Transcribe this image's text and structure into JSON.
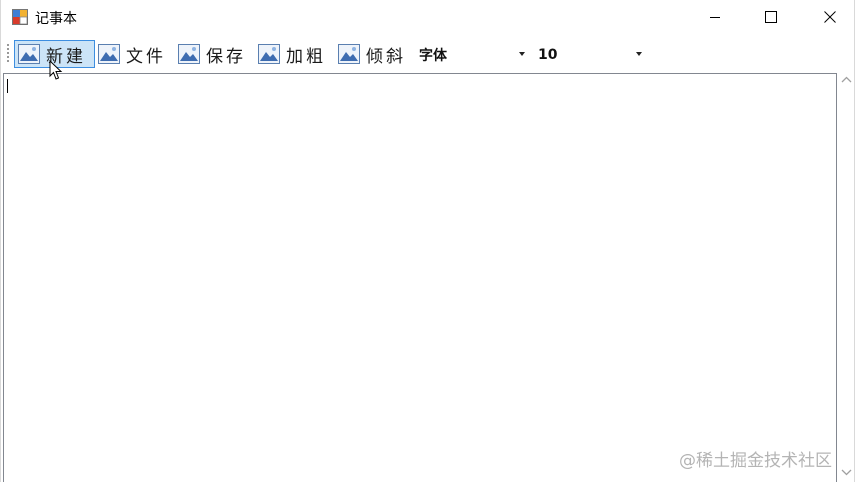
{
  "window": {
    "title": "记事本"
  },
  "toolbar": {
    "buttons": [
      {
        "label": "新建",
        "icon": "picture-icon",
        "hovered": true
      },
      {
        "label": "文件",
        "icon": "picture-icon"
      },
      {
        "label": "保存",
        "icon": "picture-icon"
      },
      {
        "label": "加粗",
        "icon": "picture-icon"
      },
      {
        "label": "倾斜",
        "icon": "picture-icon"
      }
    ],
    "font_combo": {
      "value": "字体"
    },
    "size_combo": {
      "value": "10"
    }
  },
  "editor": {
    "text": ""
  },
  "watermark": "@稀土掘金技术社区",
  "colors": {
    "hover_bg": "#cce4f7",
    "hover_border": "#3d8ee0",
    "editor_border": "#828790"
  }
}
